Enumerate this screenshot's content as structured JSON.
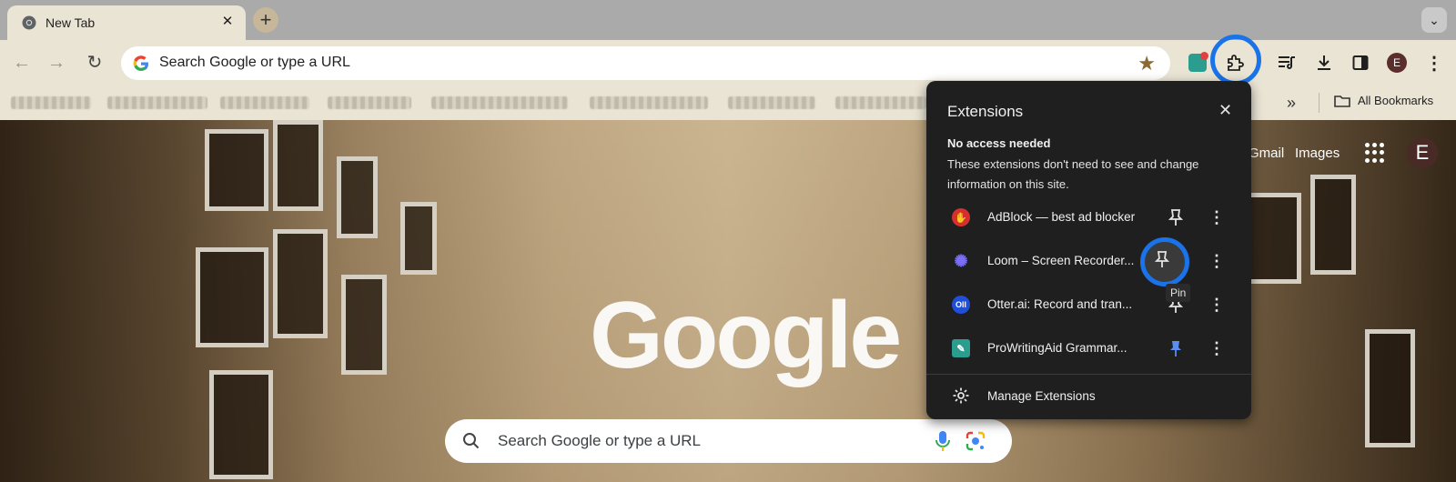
{
  "tab": {
    "title": "New Tab",
    "close": "✕"
  },
  "new_tab": "+",
  "tab_search": "⌄",
  "toolbar": {
    "omnibox_text": "Search Google or type a URL",
    "avatar_initial": "E"
  },
  "bookmarks": {
    "overflow": "»",
    "all_bookmarks": "All Bookmarks"
  },
  "ntp": {
    "logo": "Google",
    "gmail": "Gmail",
    "images": "Images",
    "avatar_initial": "E",
    "search_placeholder": "Search Google or type a URL"
  },
  "extensions_popup": {
    "title": "Extensions",
    "close": "✕",
    "section_heading": "No access needed",
    "section_desc": "These extensions don't need to see and change information on this site.",
    "items": [
      {
        "name": "AdBlock — best ad blocker",
        "pinned": false,
        "color": "#d62f2f"
      },
      {
        "name": "Loom – Screen Recorder...",
        "pinned": false,
        "color": "#625df5"
      },
      {
        "name": "Otter.ai: Record and tran...",
        "pinned": false,
        "color": "#1f4fd8"
      },
      {
        "name": "ProWritingAid Grammar...",
        "pinned": true,
        "color": "#2a9d8f"
      }
    ],
    "tooltip": "Pin",
    "manage": "Manage Extensions"
  },
  "colors": {
    "highlight_ring": "#1a73e8",
    "pinned": "#5b8def"
  }
}
